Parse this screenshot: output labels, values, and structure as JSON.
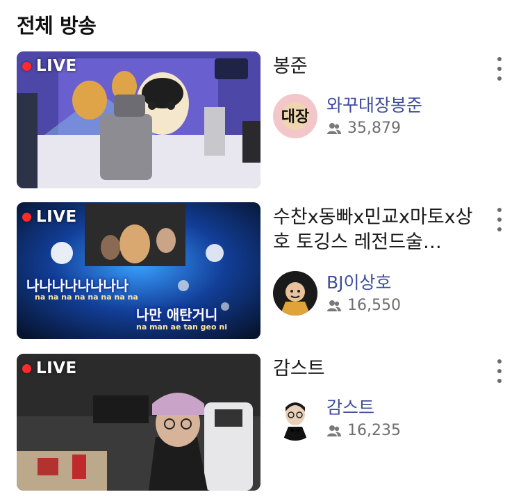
{
  "section": {
    "title": "전체 방송"
  },
  "broadcasts": [
    {
      "live_label": "LIVE",
      "title": "봉준",
      "channel": "와꾸대장봉준",
      "viewers": "35,879",
      "avatar_text": "대장",
      "thumb_colors": [
        "#5a4bb7",
        "#e9e1c6",
        "#2a2a55"
      ]
    },
    {
      "live_label": "LIVE",
      "title": "수찬x동빠x민교x마토x상호 토깅스 레전드술…",
      "channel": "BJ이상호",
      "viewers": "16,550",
      "thumb_colors": [
        "#0d2a6b",
        "#3aa0ff",
        "#0a1430"
      ],
      "caption_ko_1": "나나나나나나나나",
      "caption_roman_1": "na na na na na na na na",
      "caption_ko_2": "나만 애탄거니",
      "caption_roman_2": "na man ae tan geo ni"
    },
    {
      "live_label": "LIVE",
      "title": "감스트",
      "channel": "감스트",
      "viewers": "16,235",
      "thumb_colors": [
        "#3b3b3b",
        "#c9a3c8",
        "#e8e8e8"
      ]
    }
  ],
  "icons": {
    "more": "more-vertical-icon",
    "viewers": "people-icon",
    "live": "live-dot-icon"
  },
  "colors": {
    "channel": "#3f4d9c",
    "live_dot": "#ff2a2a",
    "meta": "#6e6e6e"
  }
}
